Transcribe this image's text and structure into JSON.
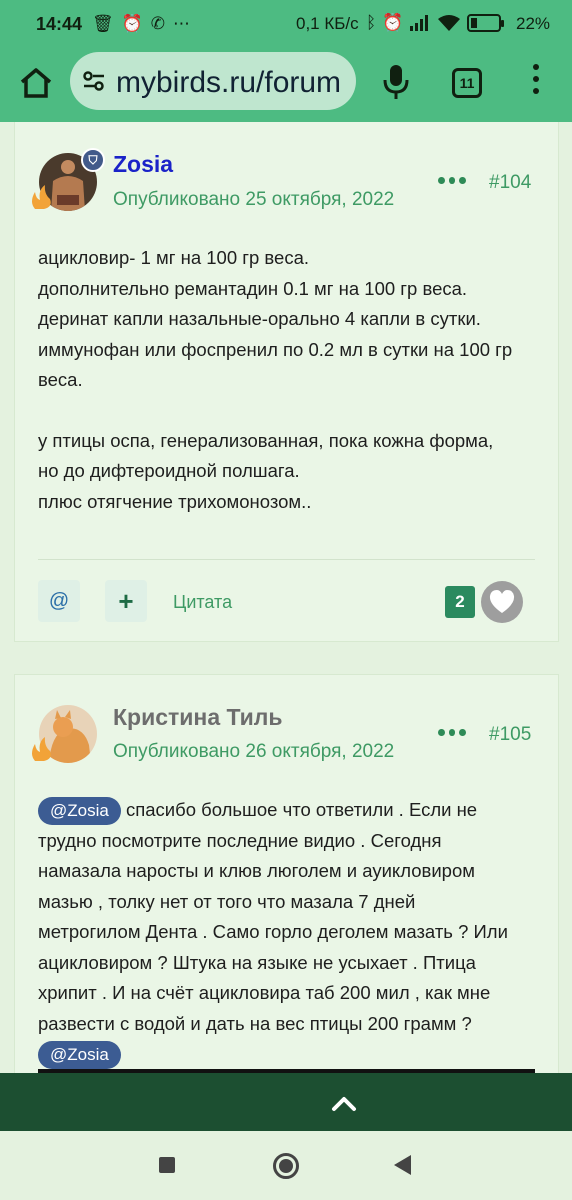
{
  "status_bar": {
    "time": "14:44",
    "left_icons": [
      "trash-icon",
      "alarm-icon",
      "viber-icon",
      "more-icon"
    ],
    "left_glyphs": [
      "🗑",
      "⏰",
      "✆",
      "⋯"
    ],
    "rate": "0,1 КБ/с",
    "right_icons": [
      "bluetooth-icon",
      "alarm-icon",
      "signal-icon",
      "wifi-icon",
      "battery-icon"
    ],
    "right_glyphs": [
      "ᛒ",
      "⏰",
      "▮",
      "◠"
    ],
    "battery_level": 0.22,
    "battery_pct": "22"
  },
  "browser": {
    "url": "mybirds.ru/forum",
    "tab_count": "11",
    "accent": "#4dbb82"
  },
  "posts": [
    {
      "author": "Zosia",
      "date": "Опубликовано 25 октября, 2022",
      "number": "#104",
      "badge": "⛉",
      "lines": [
        "ацикловир- 1 мг на 100 гр веса.",
        "дополнительно ремантадин 0.1 мг на 100 гр веса.",
        "деринат капли назальные-орально 4 капли в сутки.",
        "иммунофан или фоспренил по 0.2 мл в сутки на 100 гр",
        "веса.",
        "",
        "у птицы оспа, генерализованная, пока кожна форма,",
        "но до дифтероидной полшага.",
        "плюс отягчение трихомонозом.."
      ],
      "mention_button": "@",
      "plus_button": "+",
      "quote_label": "Цитата",
      "likes": "2"
    },
    {
      "author": "Кристина Тиль",
      "date": "Опубликовано 26 октября, 2022",
      "number": "#105",
      "mention": "@Zosia",
      "lines": [
        "спасибо большое что ответили . Если не",
        "трудно посмотрите последние видио . Сегодня",
        "намазала наросты и клюв люголем и ауикловиром",
        "мазью , толку нет от того что мазала 7 дней",
        "метрогилом Дента . Само горло деголем мазать ? Или",
        "ацикловиром ? Штука на языке не усыхает . Птица",
        "хрипит . И на счёт ацикловира таб 200 мил , как мне",
        "развести с водой и дать на вес птицы 200 грамм ?"
      ],
      "mention_end": "@Zosia"
    }
  ]
}
